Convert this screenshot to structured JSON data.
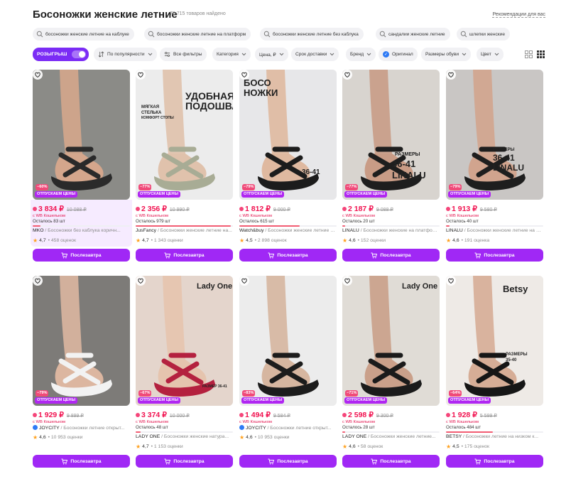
{
  "header": {
    "title": "Босоножки женские летние",
    "count": "78 715 товаров найдено",
    "recommendations": "Рекомендации для вас"
  },
  "queries": [
    "босоножки женские летние на каблуке",
    "босоножки женские летние на платформ",
    "босоножки женские летние без каблука",
    "сандалии женские летние",
    "шлепки женские"
  ],
  "filters": {
    "promo": "РОЗЫГРЫШ",
    "sort": "По популярности",
    "all": "Все фильтры",
    "category": "Категория",
    "price": "Цена, ₽",
    "delivery": "Срок доставки",
    "brand": "Бренд",
    "original": "Оригинал",
    "sizes": "Размеры обуви",
    "color": "Цвет"
  },
  "colors": {
    "accent": "#a028f5",
    "promo": "#7b2cf5",
    "price": "#f1114f",
    "discount": "#f04a79"
  },
  "products": [
    {
      "discount": "−60%",
      "badge": "ОТПУСКАЕМ ЦЕНЫ",
      "price": "3 834 ₽",
      "old_price": "10 088 ₽",
      "wallet": "с WB Кошельком",
      "left": "Осталось 83 шт",
      "stock": 0.08,
      "brand": "MKO",
      "name": " / Босоножки без каблука коричн...",
      "rating": "4,7",
      "reviews": "• 458 оценок",
      "button": "Послезавтра",
      "verified": false,
      "overlay": [],
      "highlight": true
    },
    {
      "discount": "−77%",
      "badge": "ОТПУСКАЕМ ЦЕНЫ",
      "price": "2 356 ₽",
      "old_price": "10 990 ₽",
      "wallet": "с WB Кошельком",
      "left": "Осталось 979 шт",
      "stock": 0.98,
      "brand": "JusFancy",
      "name": " / Босоножки женские летние на...",
      "rating": "4,7",
      "reviews": "• 1 343 оценки",
      "button": "Послезавтра",
      "verified": false,
      "overlay": [
        "УДОБНАЯ",
        "ПОДОШВА",
        "МЯГКАЯ",
        "СТЕЛЬКА",
        "КОМФОРТ СТОПЫ"
      ]
    },
    {
      "discount": "−79%",
      "badge": "ОТПУСКАЕМ ЦЕНЫ",
      "price": "1 812 ₽",
      "old_price": "9 000 ₽",
      "wallet": "с WB Кошельком",
      "left": "Осталось 615 шт",
      "stock": 0.62,
      "brand": "Watch&buy",
      "name": " / Босоножки женские летние на плат...",
      "rating": "4,5",
      "reviews": "• 2 898 оценок",
      "button": "Послезавтра",
      "verified": false,
      "overlay": [
        "БОСО",
        "НОЖКИ",
        "36-41"
      ]
    },
    {
      "discount": "−77%",
      "badge": "ОТПУСКАЕМ ЦЕНЫ",
      "price": "2 187 ₽",
      "old_price": "9 088 ₽",
      "wallet": "с WB Кошельком",
      "left": "Осталось 20 шт",
      "stock": 0.02,
      "brand": "LINALU",
      "name": " / Босоножки женские на платформ...",
      "rating": "4,6",
      "reviews": "• 152 оценки",
      "button": "Послезавтра",
      "verified": false,
      "overlay": [
        "РАЗМЕРЫ",
        "36-41",
        "LINALU"
      ]
    },
    {
      "discount": "−79%",
      "badge": "ОТПУСКАЕМ ЦЕНЫ",
      "price": "1 913 ₽",
      "old_price": "9 580 ₽",
      "wallet": "с WB Кошельком",
      "left": "Осталось 40 шт",
      "stock": 0.04,
      "brand": "LINALU",
      "name": " / Босоножки женские летние на плат...",
      "rating": "4,6",
      "reviews": "• 191 оценка",
      "button": "Послезавтра",
      "verified": false,
      "overlay": [
        "РАЗМЕРЫ",
        "36-41",
        "LINALU"
      ]
    },
    {
      "discount": "−79%",
      "badge": "ОТПУСКАЕМ ЦЕНЫ",
      "price": "1 929 ₽",
      "old_price": "9 899 ₽",
      "wallet": "с WB Кошельком",
      "left": "",
      "stock": 0,
      "brand": "JOYCITY",
      "name": " / Босоножки летние открыт...",
      "rating": "4,6",
      "reviews": "• 10 953 оценки",
      "button": "Послезавтра",
      "verified": true,
      "overlay": []
    },
    {
      "discount": "−67%",
      "badge": "ОТПУСКАЕМ ЦЕНЫ",
      "price": "3 374 ₽",
      "old_price": "10 000 ₽",
      "wallet": "с WB Кошельком",
      "left": "Осталось 48 шт",
      "stock": 0.05,
      "brand": "LADY ONE",
      "name": " / Босоножки женские натура...",
      "rating": "4,7",
      "reviews": "• 1 153 оценки",
      "button": "Послезавтра",
      "verified": false,
      "overlay": [
        "Lady One",
        "РАЗМЕР 36-41"
      ]
    },
    {
      "discount": "−83%",
      "badge": "ОТПУСКАЕМ ЦЕНЫ",
      "price": "1 494 ₽",
      "old_price": "9 584 ₽",
      "wallet": "с WB Кошельком",
      "left": "",
      "stock": 0,
      "brand": "JOYCITY",
      "name": " / Босоножки летние открыт...",
      "rating": "4,6",
      "reviews": "• 10 953 оценки",
      "button": "Послезавтра",
      "verified": true,
      "overlay": []
    },
    {
      "discount": "−71%",
      "badge": "ОТПУСКАЕМ ЦЕНЫ",
      "price": "2 598 ₽",
      "old_price": "9 300 ₽",
      "wallet": "с WB Кошельком",
      "left": "Осталось 28 шт",
      "stock": 0.03,
      "brand": "LADY ONE",
      "name": " / Босоножки женские летние...",
      "rating": "4,6",
      "reviews": "• 58 оценок",
      "button": "Послезавтра",
      "verified": false,
      "overlay": [
        "Lady One"
      ]
    },
    {
      "discount": "−64%",
      "badge": "ОТПУСКАЕМ ЦЕНЫ",
      "price": "1 928 ₽",
      "old_price": "5 599 ₽",
      "wallet": "с WB Кошельком",
      "left": "Осталось 484 шт",
      "stock": 0.48,
      "brand": "BETSY",
      "name": " / Босоножки летние на низком к...",
      "rating": "4,5",
      "reviews": "• 175 оценок",
      "button": "Послезавтра",
      "verified": false,
      "overlay": [
        "Betsy",
        "РАЗМЕРЫ",
        "35-40"
      ]
    }
  ]
}
